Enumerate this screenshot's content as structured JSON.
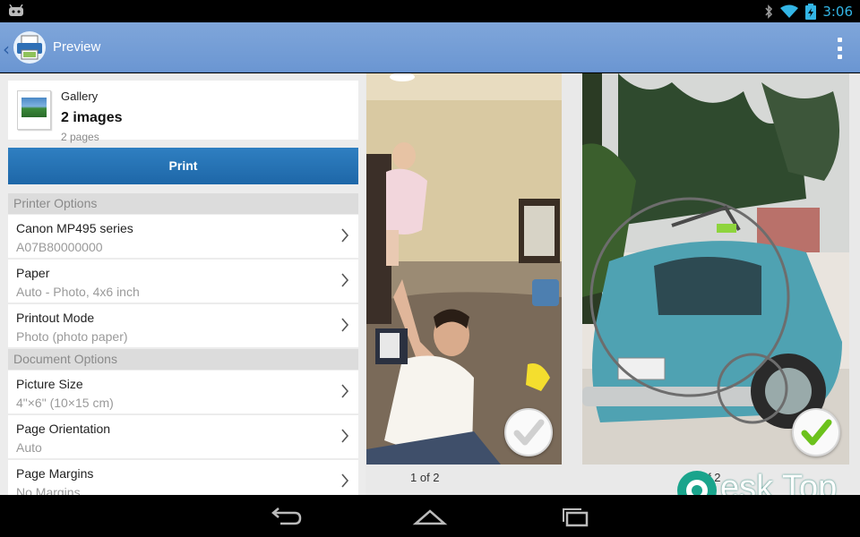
{
  "status": {
    "time": "3:06"
  },
  "actionbar": {
    "title": "Preview"
  },
  "source": {
    "label": "Gallery",
    "count": "2 images",
    "pages": "2 pages"
  },
  "print_label": "Print",
  "sections": {
    "printer": "Printer Options",
    "document": "Document Options"
  },
  "printer_options": [
    {
      "title": "Canon MP495 series",
      "value": "A07B80000000"
    },
    {
      "title": "Paper",
      "value": "Auto - Photo, 4x6 inch"
    },
    {
      "title": "Printout Mode",
      "value": "Photo (photo paper)"
    }
  ],
  "document_options": [
    {
      "title": "Picture Size",
      "value": "4\"×6\" (10×15 cm)"
    },
    {
      "title": "Page Orientation",
      "value": "Auto"
    },
    {
      "title": "Page Margins",
      "value": "No Margins"
    }
  ],
  "photos": [
    {
      "page": "1 of 2",
      "selected": false
    },
    {
      "page": "2 of 2",
      "selected": true
    }
  ],
  "watermark": "esk Top",
  "colors": {
    "actionbar": "#7fa6da",
    "print_button": "#2372b4",
    "check_green": "#6cc21c",
    "status_time": "#33b5e5"
  }
}
